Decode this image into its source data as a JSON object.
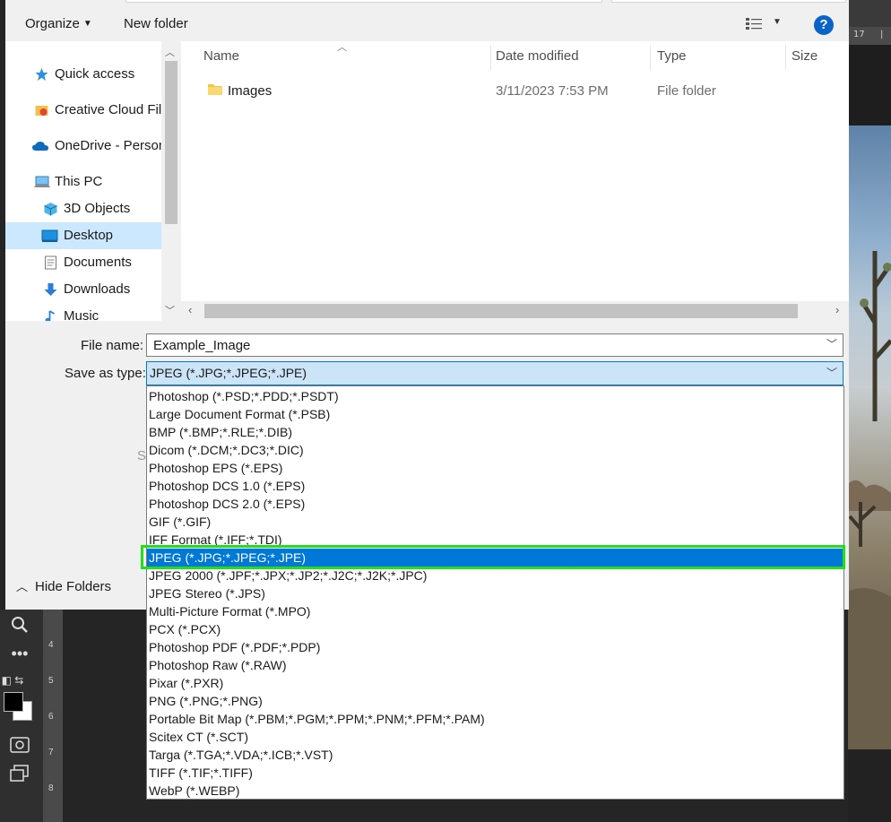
{
  "dialog": {
    "toolbar": {
      "organize_label": "Organize",
      "new_folder_label": "New folder",
      "help_label": "?"
    },
    "nav": {
      "items": [
        {
          "label": "Quick access"
        },
        {
          "label": "Creative Cloud Files"
        },
        {
          "label": "OneDrive - Personal"
        },
        {
          "label": "This PC"
        },
        {
          "label": "3D Objects"
        },
        {
          "label": "Desktop"
        },
        {
          "label": "Documents"
        },
        {
          "label": "Downloads"
        },
        {
          "label": "Music"
        }
      ],
      "selected": "Desktop"
    },
    "files": {
      "columns": [
        "Name",
        "Date modified",
        "Type",
        "Size"
      ],
      "rows": [
        {
          "name": "Images",
          "date_modified": "3/11/2023 7:53 PM",
          "type": "File folder",
          "size": ""
        }
      ]
    },
    "form": {
      "file_name_label": "File name:",
      "file_name_value": "Example_Image",
      "save_as_type_label": "Save as type:",
      "save_as_type_value": "JPEG (*.JPG;*.JPEG;*.JPE)",
      "hide_folders_label": "Hide Folders",
      "obscured_text": "S"
    },
    "save_type_options": [
      "Photoshop (*.PSD;*.PDD;*.PSDT)",
      "Large Document Format (*.PSB)",
      "BMP (*.BMP;*.RLE;*.DIB)",
      "Dicom (*.DCM;*.DC3;*.DIC)",
      "Photoshop EPS (*.EPS)",
      "Photoshop DCS 1.0 (*.EPS)",
      "Photoshop DCS 2.0 (*.EPS)",
      "GIF (*.GIF)",
      "IFF Format (*.IFF;*.TDI)",
      "JPEG (*.JPG;*.JPEG;*.JPE)",
      "JPEG 2000 (*.JPF;*.JPX;*.JP2;*.J2C;*.J2K;*.JPC)",
      "JPEG Stereo (*.JPS)",
      "Multi-Picture Format (*.MPO)",
      "PCX (*.PCX)",
      "Photoshop PDF (*.PDF;*.PDP)",
      "Photoshop Raw (*.RAW)",
      "Pixar (*.PXR)",
      "PNG (*.PNG;*.PNG)",
      "Portable Bit Map (*.PBM;*.PGM;*.PPM;*.PNM;*.PFM;*.PAM)",
      "Scitex CT (*.SCT)",
      "Targa (*.TGA;*.VDA;*.ICB;*.VST)",
      "TIFF (*.TIF;*.TIFF)",
      "WebP (*.WEBP)"
    ],
    "selected_option": "JPEG (*.JPG;*.JPEG;*.JPE)"
  },
  "photoshop": {
    "ruler_top_labels": [
      "17",
      "|"
    ],
    "ruler_left_labels": [
      "4",
      "5",
      "6",
      "7",
      "8"
    ]
  },
  "colors": {
    "selection_blue": "#0078d7",
    "highlight_green": "#21e01b",
    "nav_selected": "#cce8ff",
    "help_blue": "#0a64c8"
  }
}
